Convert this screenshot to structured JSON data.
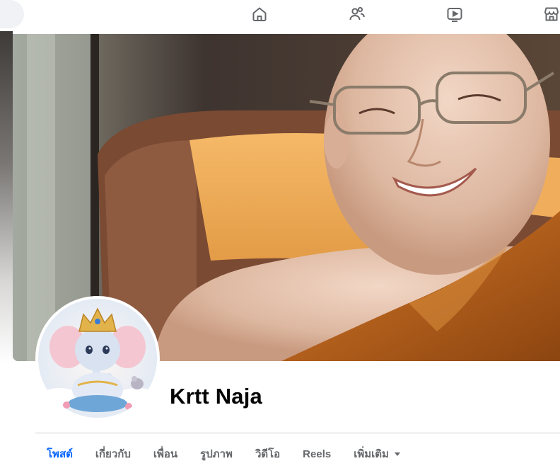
{
  "topnav": {
    "items": [
      {
        "icon": "home-icon"
      },
      {
        "icon": "friends-icon"
      },
      {
        "icon": "video-icon"
      },
      {
        "icon": "marketplace-icon"
      }
    ]
  },
  "profile": {
    "name": "Krtt Naja"
  },
  "tabs": {
    "posts": "โพสต์",
    "about": "เกี่ยวกับ",
    "friends": "เพื่อน",
    "photos": "รูปภาพ",
    "videos": "วิดีโอ",
    "reels": "Reels",
    "more": "เพิ่มเติม"
  },
  "colors": {
    "accent": "#0866ff",
    "tab_inactive": "#65676b",
    "divider": "#ced0d4"
  }
}
